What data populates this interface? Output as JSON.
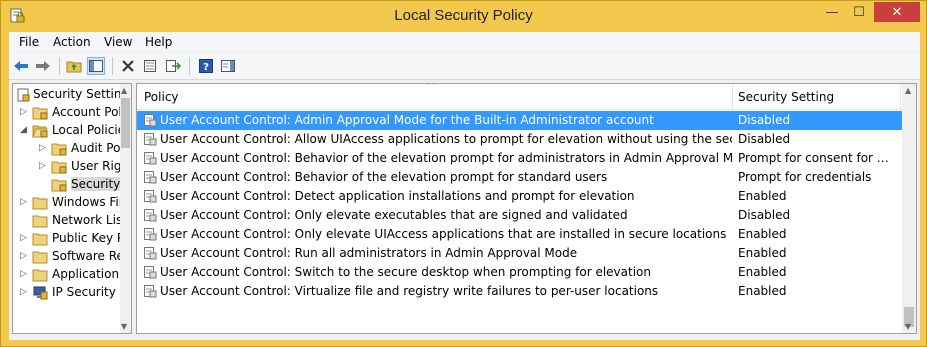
{
  "window": {
    "title": "Local Security Policy",
    "close_glyph": "✕",
    "min_glyph": "—",
    "max_glyph": "☐"
  },
  "menu": [
    {
      "label": "File"
    },
    {
      "label": "Action"
    },
    {
      "label": "View"
    },
    {
      "label": "Help"
    }
  ],
  "toolbar": {
    "icons": [
      "back-arrow-icon",
      "forward-arrow-icon",
      "up-folder-icon",
      "show-hide-tree-icon",
      "delete-icon",
      "properties-icon",
      "export-list-icon",
      "help-icon",
      "show-action-pane-icon"
    ]
  },
  "tree": {
    "items": [
      {
        "label": "Security Settings",
        "level": 0,
        "expander": "",
        "icon": "security-settings-icon"
      },
      {
        "label": "Account Policies",
        "level": 1,
        "expander": "▷",
        "icon": "folder-icon"
      },
      {
        "label": "Local Policies",
        "level": 1,
        "expander": "◢",
        "icon": "folder-open-icon"
      },
      {
        "label": "Audit Policy",
        "level": 2,
        "expander": "▷",
        "icon": "folder-icon"
      },
      {
        "label": "User Rights Assignment",
        "level": 2,
        "expander": "▷",
        "icon": "folder-icon"
      },
      {
        "label": "Security Options",
        "level": 2,
        "expander": "",
        "icon": "folder-icon",
        "selected": true
      },
      {
        "label": "Windows Firewall with Advanced Security",
        "level": 1,
        "expander": "▷",
        "icon": "folder-icon"
      },
      {
        "label": "Network List Manager Policies",
        "level": 1,
        "expander": "",
        "icon": "folder-icon"
      },
      {
        "label": "Public Key Policies",
        "level": 1,
        "expander": "▷",
        "icon": "folder-icon"
      },
      {
        "label": "Software Restriction Policies",
        "level": 1,
        "expander": "▷",
        "icon": "folder-icon"
      },
      {
        "label": "Application Control Policies",
        "level": 1,
        "expander": "▷",
        "icon": "folder-icon"
      },
      {
        "label": "IP Security Policies on Local Computer",
        "level": 1,
        "expander": "▷",
        "icon": "ip-security-icon"
      }
    ]
  },
  "list": {
    "columns": {
      "policy": "Policy",
      "setting": "Security Setting"
    },
    "sort_glyph": "^",
    "rows": [
      {
        "policy": "User Account Control: Admin Approval Mode for the Built-in Administrator account",
        "setting": "Disabled",
        "selected": true
      },
      {
        "policy": "User Account Control: Allow UIAccess applications to prompt for elevation without using the secure desktop",
        "setting": "Disabled"
      },
      {
        "policy": "User Account Control: Behavior of the elevation prompt for administrators in Admin Approval Mode",
        "setting": "Prompt for consent for non-Windows binaries"
      },
      {
        "policy": "User Account Control: Behavior of the elevation prompt for standard users",
        "setting": "Prompt for credentials"
      },
      {
        "policy": "User Account Control: Detect application installations and prompt for elevation",
        "setting": "Enabled"
      },
      {
        "policy": "User Account Control: Only elevate executables that are signed and validated",
        "setting": "Disabled"
      },
      {
        "policy": "User Account Control: Only elevate UIAccess applications that are installed in secure locations",
        "setting": "Enabled"
      },
      {
        "policy": "User Account Control: Run all administrators in Admin Approval Mode",
        "setting": "Enabled"
      },
      {
        "policy": "User Account Control: Switch to the secure desktop when prompting for elevation",
        "setting": "Enabled"
      },
      {
        "policy": "User Account Control: Virtualize file and registry write failures to per-user locations",
        "setting": "Enabled"
      }
    ]
  },
  "colors": {
    "frame": "#f2c94c",
    "selection": "#3399ff",
    "close": "#c7403c"
  }
}
